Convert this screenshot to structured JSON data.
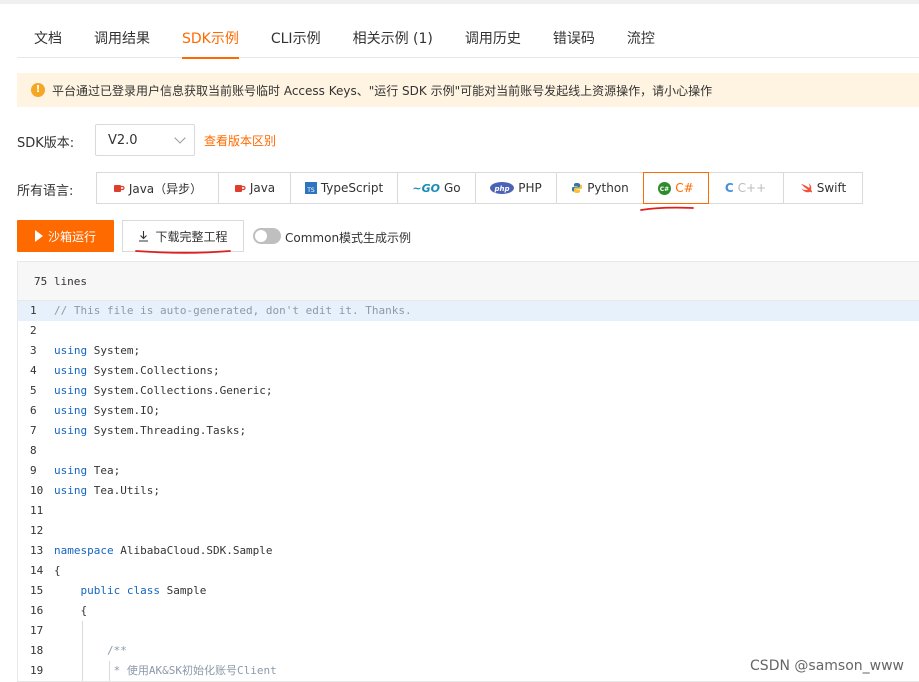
{
  "tabs": [
    {
      "label": "文档",
      "active": false
    },
    {
      "label": "调用结果",
      "active": false
    },
    {
      "label": "SDK示例",
      "active": true
    },
    {
      "label": "CLI示例",
      "active": false
    },
    {
      "label": "相关示例 (1)",
      "active": false
    },
    {
      "label": "调用历史",
      "active": false
    },
    {
      "label": "错误码",
      "active": false
    },
    {
      "label": "流控",
      "active": false
    }
  ],
  "notice": {
    "icon": "warning-icon",
    "text": "平台通过已登录用户信息获取当前账号临时 Access Keys、\"运行 SDK 示例\"可能对当前账号发起线上资源操作，请小心操作"
  },
  "sdk_version": {
    "label": "SDK版本:",
    "value": "V2.0",
    "link": "查看版本区别"
  },
  "languages": {
    "label": "所有语言:",
    "items": [
      {
        "label": "Java（异步）",
        "icon": "java-cup-icon",
        "active": false,
        "disabled": false
      },
      {
        "label": "Java",
        "icon": "java-cup-icon",
        "active": false,
        "disabled": false
      },
      {
        "label": "TypeScript",
        "icon": "typescript-icon",
        "active": false,
        "disabled": false
      },
      {
        "label": "Go",
        "icon": "go-icon",
        "active": false,
        "disabled": false
      },
      {
        "label": "PHP",
        "icon": "php-icon",
        "active": false,
        "disabled": false
      },
      {
        "label": "Python",
        "icon": "python-icon",
        "active": false,
        "disabled": false
      },
      {
        "label": "C#",
        "icon": "csharp-icon",
        "active": true,
        "disabled": false
      },
      {
        "label": "C++",
        "icon": "cpp-icon",
        "active": false,
        "disabled": true
      },
      {
        "label": "Swift",
        "icon": "swift-icon",
        "active": false,
        "disabled": false
      }
    ]
  },
  "actions": {
    "run_label": "沙箱运行",
    "download_label": "下载完整工程",
    "toggle_label": "Common模式生成示例",
    "toggle_on": false
  },
  "code": {
    "header": "75 lines",
    "lines": [
      {
        "n": "1",
        "parts": [
          {
            "t": "// This file is auto-generated, don't edit it. Thanks.",
            "c": "cm"
          }
        ]
      },
      {
        "n": "2",
        "parts": []
      },
      {
        "n": "3",
        "parts": [
          {
            "t": "using",
            "c": "kw"
          },
          {
            "t": " System;",
            "c": ""
          }
        ]
      },
      {
        "n": "4",
        "parts": [
          {
            "t": "using",
            "c": "kw"
          },
          {
            "t": " System.Collections;",
            "c": ""
          }
        ]
      },
      {
        "n": "5",
        "parts": [
          {
            "t": "using",
            "c": "kw"
          },
          {
            "t": " System.Collections.Generic;",
            "c": ""
          }
        ]
      },
      {
        "n": "6",
        "parts": [
          {
            "t": "using",
            "c": "kw"
          },
          {
            "t": " System.IO;",
            "c": ""
          }
        ]
      },
      {
        "n": "7",
        "parts": [
          {
            "t": "using",
            "c": "kw"
          },
          {
            "t": " System.Threading.Tasks;",
            "c": ""
          }
        ]
      },
      {
        "n": "8",
        "parts": []
      },
      {
        "n": "9",
        "parts": [
          {
            "t": "using",
            "c": "kw"
          },
          {
            "t": " Tea;",
            "c": ""
          }
        ]
      },
      {
        "n": "10",
        "parts": [
          {
            "t": "using",
            "c": "kw"
          },
          {
            "t": " Tea.Utils;",
            "c": ""
          }
        ]
      },
      {
        "n": "11",
        "parts": []
      },
      {
        "n": "12",
        "parts": []
      },
      {
        "n": "13",
        "parts": [
          {
            "t": "namespace",
            "c": "kw"
          },
          {
            "t": " AlibabaCloud.SDK.Sample",
            "c": ""
          }
        ]
      },
      {
        "n": "14",
        "parts": [
          {
            "t": "{",
            "c": ""
          }
        ]
      },
      {
        "n": "15",
        "parts": [
          {
            "t": "    ",
            "c": ""
          },
          {
            "t": "public",
            "c": "kw"
          },
          {
            "t": " ",
            "c": ""
          },
          {
            "t": "class",
            "c": "kw"
          },
          {
            "t": " Sample",
            "c": ""
          }
        ]
      },
      {
        "n": "16",
        "parts": [
          {
            "t": "    {",
            "c": ""
          }
        ]
      },
      {
        "n": "17",
        "parts": []
      },
      {
        "n": "18",
        "parts": [
          {
            "t": "        ",
            "c": ""
          },
          {
            "t": "/**",
            "c": "cm"
          }
        ]
      },
      {
        "n": "19",
        "parts": [
          {
            "t": "         ",
            "c": ""
          },
          {
            "t": "* 使用AK&SK初始化账号Client",
            "c": "cm"
          }
        ]
      }
    ]
  },
  "watermark": "CSDN @samson_www",
  "colors": {
    "accent": "#ff6a00",
    "keyword": "#1565c0",
    "comment": "#8c9aa8",
    "annotation": "#e02020"
  }
}
